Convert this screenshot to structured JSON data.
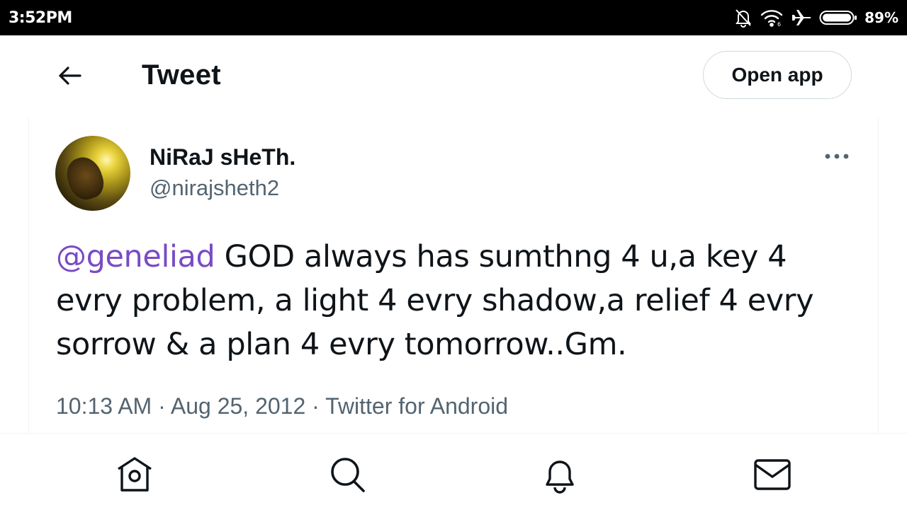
{
  "status_bar": {
    "time": "3:52PM",
    "battery_percent": "89%",
    "icons": [
      "bell-off-icon",
      "wifi-icon",
      "airplane-icon",
      "battery-icon"
    ]
  },
  "header": {
    "back_icon": "arrow-left-icon",
    "title": "Tweet",
    "open_app_label": "Open app"
  },
  "tweet": {
    "display_name": "NiRaJ sHeTh.",
    "handle": "@nirajsheth2",
    "more_icon": "more-horizontal-icon",
    "mention": "@geneliad",
    "body": " GOD always has sumthng 4 u,a key 4 evry problem, a light 4 evry shadow,a relief 4 evry sorrow & a plan 4 evry tomorrow..Gm.",
    "time": "10:13 AM",
    "date": "Aug 25, 2012",
    "source": "Twitter for Android",
    "separator": " · ",
    "mention_color": "#794bc4"
  },
  "bottom_nav": {
    "items": [
      {
        "icon": "home-icon"
      },
      {
        "icon": "search-icon"
      },
      {
        "icon": "bell-icon"
      },
      {
        "icon": "mail-icon"
      }
    ]
  }
}
